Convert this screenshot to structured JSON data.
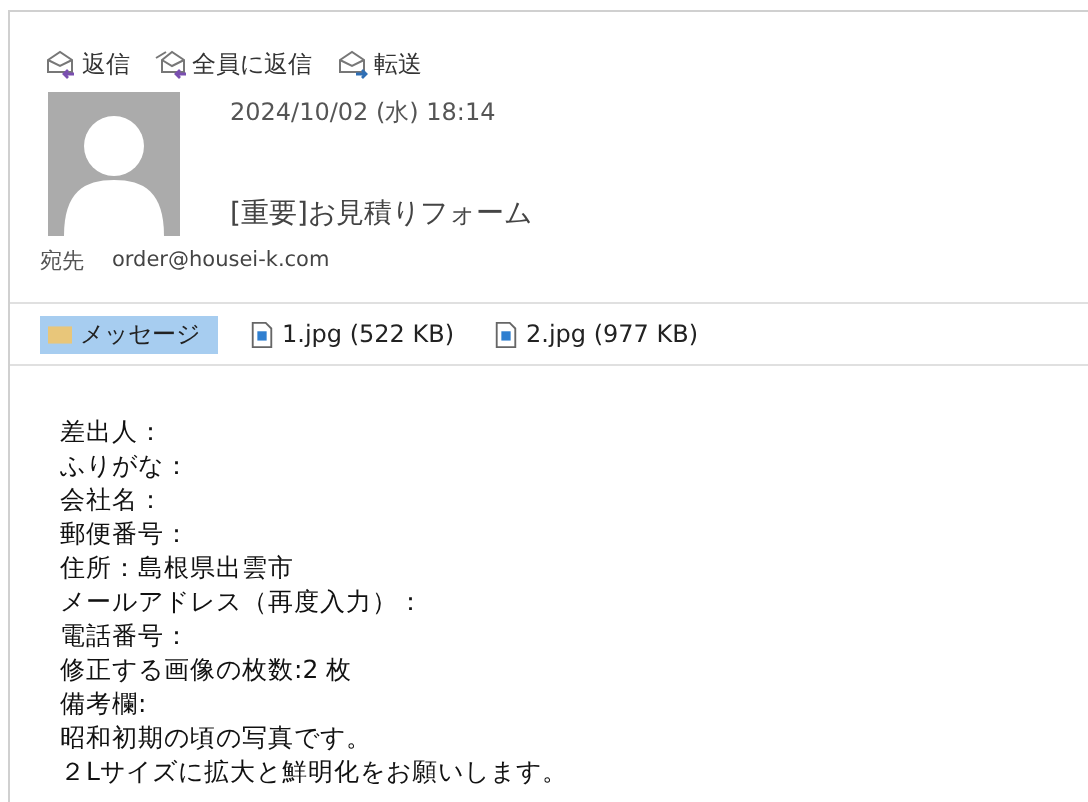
{
  "toolbar": [
    {
      "kind": "reply",
      "label": "返信"
    },
    {
      "kind": "reply_all",
      "label": "全員に返信"
    },
    {
      "kind": "forward",
      "label": "転送"
    }
  ],
  "header": {
    "date": "2024/10/02 (水) 18:14",
    "subject": "[重要]お見積りフォーム",
    "to_label": "宛先",
    "to": "order@housei-k.com"
  },
  "attachments": [
    {
      "kind": "message",
      "label": "メッセージ",
      "selected": true
    },
    {
      "kind": "file",
      "label": "1.jpg (522 KB)",
      "selected": false
    },
    {
      "kind": "file",
      "label": "2.jpg (977 KB)",
      "selected": false
    }
  ],
  "body": [
    "差出人：",
    "ふりがな：",
    "会社名：",
    "郵便番号：",
    "住所：島根県出雲市",
    "メールアドレス（再度入力）：",
    "電話番号：",
    "修正する画像の枚数:2 枚",
    "備考欄:",
    "昭和初期の頃の写真です。",
    "２Lサイズに拡大と鮮明化をお願いします。"
  ]
}
